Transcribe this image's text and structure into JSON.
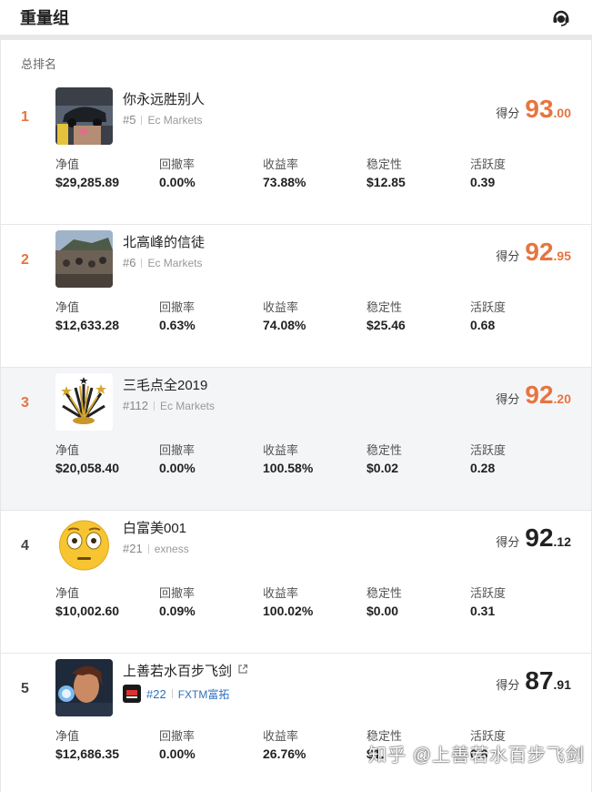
{
  "header": {
    "title": "重量组",
    "support_icon": "headset-icon"
  },
  "section_label": "总排名",
  "score_label": "得分",
  "stat_labels": [
    "净值",
    "回撤率",
    "收益率",
    "稳定性",
    "活跃度"
  ],
  "accent_color": "#e7743f",
  "rows": [
    {
      "rank": "1",
      "name": "你永远胜别人",
      "num": "#5",
      "broker": "Ec Markets",
      "score_int": "93",
      "score_dec": ".00",
      "values": [
        "$29,285.89",
        "0.00%",
        "73.88%",
        "$12.85",
        "0.39"
      ]
    },
    {
      "rank": "2",
      "name": "北高峰的信徒",
      "num": "#6",
      "broker": "Ec Markets",
      "score_int": "92",
      "score_dec": ".95",
      "values": [
        "$12,633.28",
        "0.63%",
        "74.08%",
        "$25.46",
        "0.68"
      ]
    },
    {
      "rank": "3",
      "name": "三毛点全2019",
      "num": "#112",
      "broker": "Ec Markets",
      "score_int": "92",
      "score_dec": ".20",
      "values": [
        "$20,058.40",
        "0.00%",
        "100.58%",
        "$0.02",
        "0.28"
      ]
    },
    {
      "rank": "4",
      "name": "白富美001",
      "num": "#21",
      "broker": "exness",
      "score_int": "92",
      "score_dec": ".12",
      "values": [
        "$10,002.60",
        "0.09%",
        "100.02%",
        "$0.00",
        "0.31"
      ]
    },
    {
      "rank": "5",
      "name": "上善若水百步飞剑",
      "num": "#22",
      "broker": "FXTM富拓",
      "score_int": "87",
      "score_dec": ".91",
      "values": [
        "$12,686.35",
        "0.00%",
        "26.76%",
        "$1.",
        "0.8"
      ]
    }
  ],
  "watermark": "知乎 @上善若水百步飞剑"
}
